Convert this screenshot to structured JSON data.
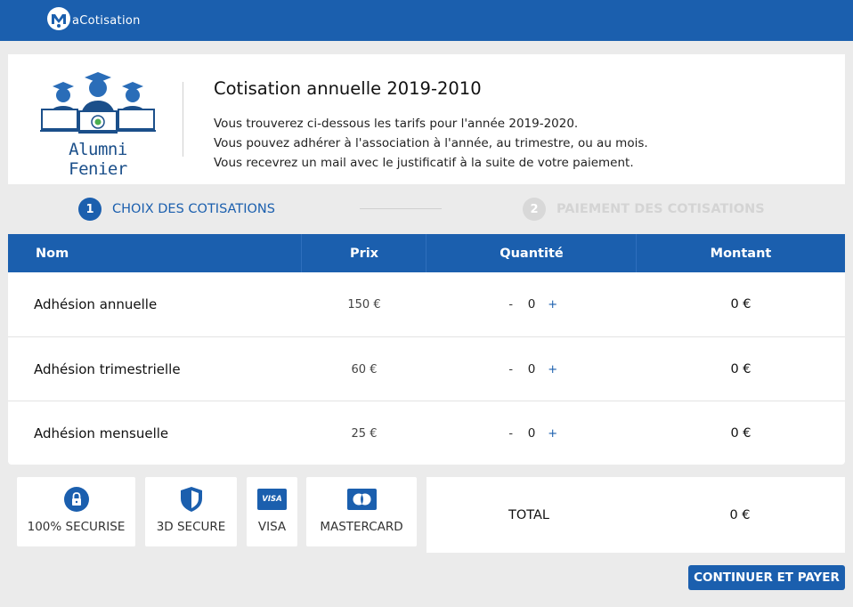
{
  "brand": {
    "name": "aCotisation",
    "icon": "app-logo-icon"
  },
  "intro": {
    "logo_text": "Alumni Fenier",
    "title": "Cotisation annuelle 2019-2010",
    "lines": [
      "Vous trouverez ci-dessous les tarifs pour l'année 2019-2020.",
      "Vous pouvez adhérer à l'association à l'année, au trimestre, ou au mois.",
      "Vous recevrez un mail avec le justificatif à la suite de votre paiement."
    ]
  },
  "steps": [
    {
      "num": "1",
      "label": "CHOIX DES COTISATIONS",
      "active": true
    },
    {
      "num": "2",
      "label": "PAIEMENT DES COTISATIONS",
      "active": false
    }
  ],
  "table": {
    "headers": {
      "name": "Nom",
      "price": "Prix",
      "qty": "Quantité",
      "amount": "Montant"
    },
    "minus": "-",
    "plus": "+",
    "rows": [
      {
        "name": "Adhésion annuelle",
        "price": "150 €",
        "qty": "0",
        "amount": "0 €"
      },
      {
        "name": "Adhésion trimestrielle",
        "price": "60 €",
        "qty": "0",
        "amount": "0 €"
      },
      {
        "name": "Adhésion mensuelle",
        "price": "25 €",
        "qty": "0",
        "amount": "0 €"
      }
    ]
  },
  "badges": [
    {
      "label": "100% SECURISE",
      "icon": "lock-icon"
    },
    {
      "label": "3D SECURE",
      "icon": "shield-icon"
    },
    {
      "label": "VISA",
      "icon": "visa-card-icon",
      "icon_text": "VISA"
    },
    {
      "label": "MASTERCARD",
      "icon": "mastercard-icon"
    }
  ],
  "total": {
    "label": "TOTAL",
    "value": "0 €"
  },
  "actions": {
    "pay_label": "CONTINUER ET PAYER"
  },
  "colors": {
    "primary": "#1b5fae",
    "background": "#ebebeb",
    "disabled": "#d4d4d4"
  }
}
